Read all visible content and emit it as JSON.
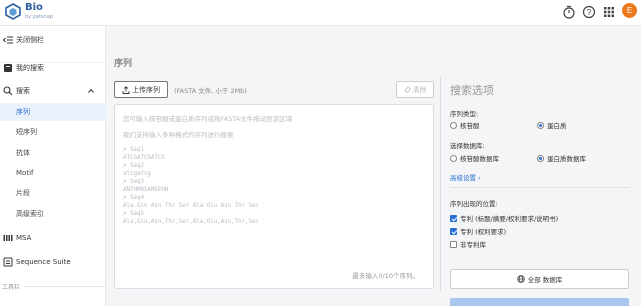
{
  "header": {
    "brand": "Bio",
    "brand_sub": "by patsnap",
    "icons": [
      "timer-icon",
      "help-icon",
      "apps-grid-icon"
    ],
    "avatar_letter": "E",
    "avatar_color": "#ec7a1c"
  },
  "sidebar": {
    "collapse_label": "关闭侧栏",
    "my_search": "我的搜索",
    "search_group": "搜索",
    "sub_items": [
      "序列",
      "短序列",
      "抗体",
      "Motif",
      "片段",
      "高级索引"
    ],
    "msa": "MSA",
    "suite": "Sequence Suite",
    "toolbar_section": "工具栏"
  },
  "main": {
    "title": "序列",
    "upload_label": "上传序列",
    "upload_hint": "(FASTA 文件, 小于 2Mb)",
    "clear_label": "清除",
    "placeholder_lines": [
      "您可输入核苷酸或蛋白质序列或拖FASTA文件拖动到该区域",
      "我们支持输入多种格式的序列进行搜索"
    ],
    "example_lines": [
      "> Seq1",
      "ATCGATCGATCG",
      "> Seq2",
      "atcgatcg",
      "> Seq3",
      "ANTHMNSAMDEHN",
      "> Seq4",
      "Ala Gln Asn Thr Ser Ala Glu Asn Thr Ser",
      "> Seq5",
      "Ala,Glu,Asn,Thr,Ser,Ala,Glu,Asn,Thr,Ser"
    ],
    "max_hint": "最多输入0/10个序列。"
  },
  "options": {
    "title": "搜索选项",
    "seq_type_label": "序列类型:",
    "seq_types": [
      {
        "label": "核苷酸",
        "selected": false
      },
      {
        "label": "蛋白质",
        "selected": true
      }
    ],
    "db_label": "选择数据库:",
    "dbs": [
      {
        "label": "核苷酸数据库",
        "selected": false
      },
      {
        "label": "蛋白质数据库",
        "selected": true
      }
    ],
    "advanced_link": "高级设置 ›",
    "position_label": "序列出现的位置:",
    "positions": [
      {
        "label": "专利 (标题/摘要/权利要求/说明书)",
        "checked": true
      },
      {
        "label": "专利 (权利要求)",
        "checked": true
      },
      {
        "label": "非专利库",
        "checked": false
      }
    ],
    "all_db_label": "全部 数据库",
    "accent_color": "#2a6fd6"
  }
}
